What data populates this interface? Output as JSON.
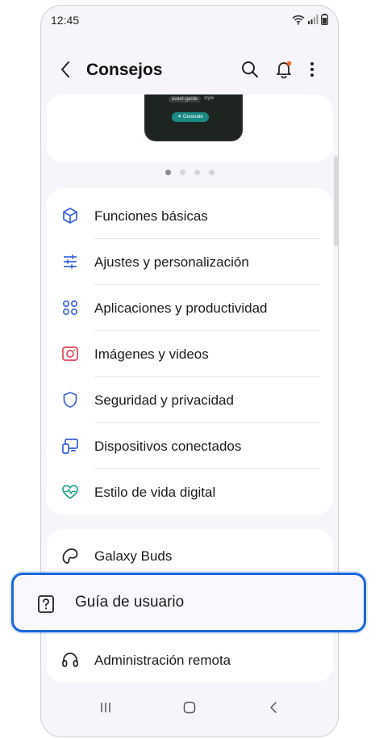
{
  "status": {
    "time": "12:45"
  },
  "header": {
    "title": "Consejos"
  },
  "banner": {
    "chip_left": "avant-garde",
    "chip_right": "style",
    "button": "✶ Generate",
    "pages": 4,
    "active_page": 1
  },
  "menu_main": [
    {
      "label": "Funciones básicas",
      "icon": "cube-icon"
    },
    {
      "label": "Ajustes y personalización",
      "icon": "sliders-icon"
    },
    {
      "label": "Aplicaciones y productividad",
      "icon": "apps-grid-icon"
    },
    {
      "label": "Imágenes y videos",
      "icon": "camera-icon"
    },
    {
      "label": "Seguridad y privacidad",
      "icon": "shield-icon"
    },
    {
      "label": "Dispositivos conectados",
      "icon": "devices-icon"
    },
    {
      "label": "Estilo de vida digital",
      "icon": "heart-pulse-icon"
    }
  ],
  "menu_more": [
    {
      "label": "Galaxy Buds",
      "icon": "earbuds-icon"
    },
    {
      "label": "Guía de usuario",
      "icon": "help-book-icon"
    },
    {
      "label": "Administración remota",
      "icon": "headset-icon"
    }
  ],
  "colors": {
    "accent_blue": "#1b67dd",
    "notification_dot": "#f26b1d",
    "icon_blue": "#3a62d8",
    "icon_red": "#e0455a",
    "icon_green": "#1fa38a"
  }
}
